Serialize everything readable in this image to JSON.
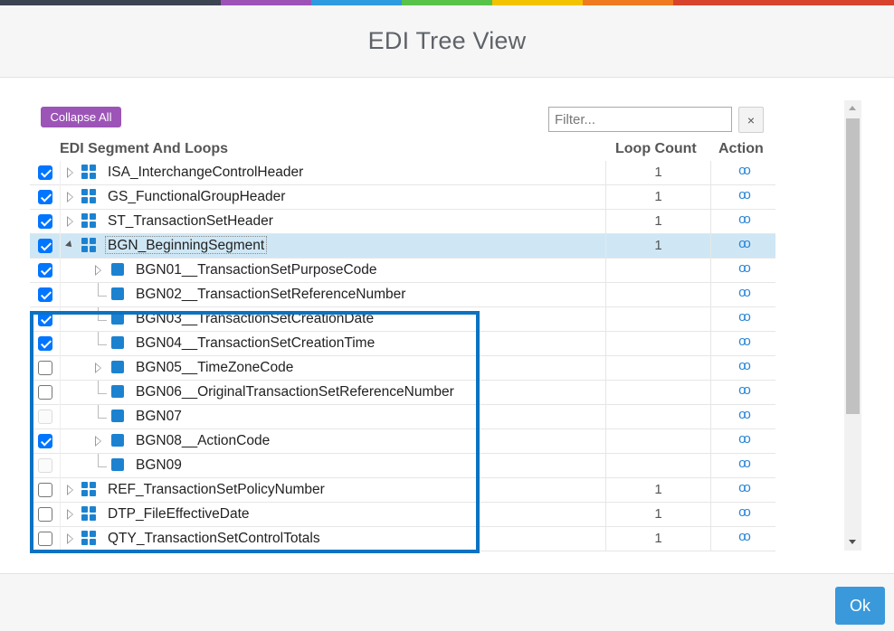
{
  "header": {
    "title": "EDI Tree View"
  },
  "top_bar_colors": [
    "#3c4351",
    "#3c4351",
    "#9d53b6",
    "#2e9ae0",
    "#59c249",
    "#f3c200",
    "#ef7a20",
    "#d8432d"
  ],
  "toolbar": {
    "collapse_label": "Collapse All",
    "filter_placeholder": "Filter...",
    "clear_label": "×"
  },
  "columns": {
    "segment": "EDI Segment And Loops",
    "count": "Loop Count",
    "action": "Action"
  },
  "action_icon": "glasses-icon",
  "action_glyph": "oo",
  "rows": [
    {
      "name": "ISA_InterchangeControlHeader",
      "count": "1",
      "checked": true,
      "level": 0,
      "expander": "collapsed",
      "icon": "grid-icon"
    },
    {
      "name": "GS_FunctionalGroupHeader",
      "count": "1",
      "checked": true,
      "level": 0,
      "expander": "collapsed",
      "icon": "grid-icon"
    },
    {
      "name": "ST_TransactionSetHeader",
      "count": "1",
      "checked": true,
      "level": 0,
      "expander": "collapsed",
      "icon": "grid-icon"
    },
    {
      "name": "BGN_BeginningSegment",
      "count": "1",
      "checked": true,
      "level": 0,
      "expander": "expanded",
      "icon": "grid-icon",
      "selected": true
    },
    {
      "name": "BGN01__TransactionSetPurposeCode",
      "count": "",
      "checked": true,
      "level": 1,
      "expander": "collapsed",
      "icon": "square-icon"
    },
    {
      "name": "BGN02__TransactionSetReferenceNumber",
      "count": "",
      "checked": true,
      "level": 1,
      "expander": "branch",
      "icon": "square-icon"
    },
    {
      "name": "BGN03__TransactionSetCreationDate",
      "count": "",
      "checked": true,
      "level": 1,
      "expander": "branch",
      "icon": "square-icon"
    },
    {
      "name": "BGN04__TransactionSetCreationTime",
      "count": "",
      "checked": true,
      "level": 1,
      "expander": "branch",
      "icon": "square-icon"
    },
    {
      "name": "BGN05__TimeZoneCode",
      "count": "",
      "checked": false,
      "level": 1,
      "expander": "collapsed",
      "icon": "square-icon"
    },
    {
      "name": "BGN06__OriginalTransactionSetReferenceNumber",
      "count": "",
      "checked": false,
      "level": 1,
      "expander": "branch",
      "icon": "square-icon"
    },
    {
      "name": "BGN07",
      "count": "",
      "checked": false,
      "disabled": true,
      "level": 1,
      "expander": "branch",
      "icon": "square-icon"
    },
    {
      "name": "BGN08__ActionCode",
      "count": "",
      "checked": true,
      "level": 1,
      "expander": "collapsed",
      "icon": "square-icon"
    },
    {
      "name": "BGN09",
      "count": "",
      "checked": false,
      "disabled": true,
      "level": 1,
      "expander": "branch",
      "icon": "square-icon"
    },
    {
      "name": "REF_TransactionSetPolicyNumber",
      "count": "1",
      "checked": false,
      "level": 0,
      "expander": "collapsed",
      "icon": "grid-icon"
    },
    {
      "name": "DTP_FileEffectiveDate",
      "count": "1",
      "checked": false,
      "level": 0,
      "expander": "collapsed",
      "icon": "grid-icon"
    },
    {
      "name": "QTY_TransactionSetControlTotals",
      "count": "1",
      "checked": false,
      "level": 0,
      "expander": "collapsed",
      "icon": "grid-icon"
    }
  ],
  "footer": {
    "ok_label": "Ok"
  }
}
